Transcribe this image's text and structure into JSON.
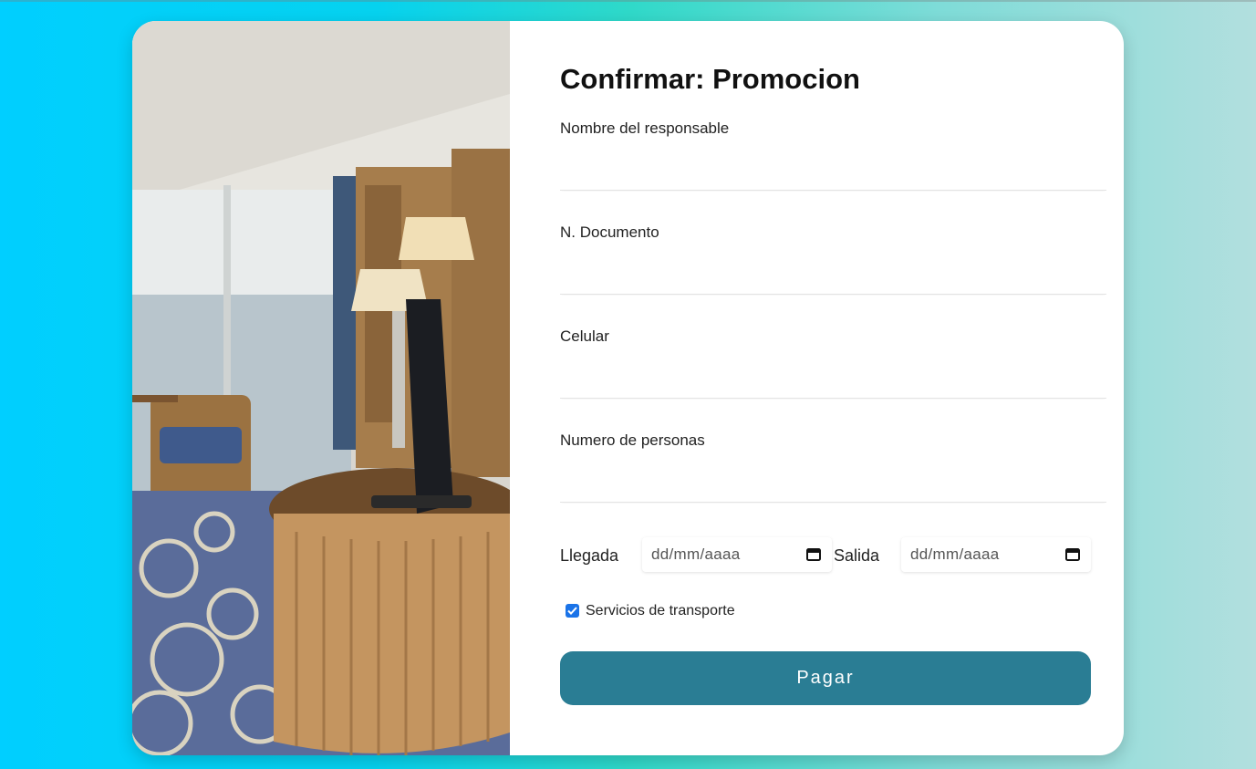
{
  "form": {
    "title": "Confirmar: Promocion",
    "fields": [
      {
        "label": "Nombre del responsable",
        "value": ""
      },
      {
        "label": "N. Documento",
        "value": ""
      },
      {
        "label": "Celular",
        "value": ""
      },
      {
        "label": "Numero de personas",
        "value": ""
      }
    ],
    "arrival": {
      "label": "Llegada",
      "placeholder": "dd/mm/aaaa"
    },
    "departure": {
      "label": "Salida",
      "placeholder": "dd/mm/aaaa"
    },
    "transport": {
      "label": "Servicios de transporte",
      "checked": true
    },
    "submit_label": "Pagar"
  },
  "colors": {
    "accent": "#2a7d94",
    "checkbox": "#1a73e8",
    "background_left": "#00cfff",
    "background_right": "#b2dfde"
  },
  "icons": {
    "date": "calendar-icon",
    "check": "checkmark-icon"
  }
}
